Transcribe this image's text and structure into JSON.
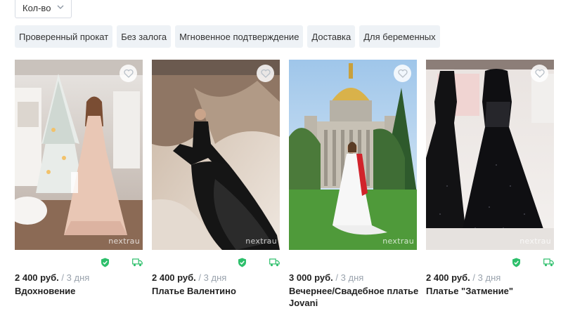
{
  "filters": {
    "quantity_select": {
      "label": "Кол-во"
    },
    "chips": [
      "Проверенный прокат",
      "Без залога",
      "Мгновенное подтверждение",
      "Доставка",
      "Для беременных"
    ]
  },
  "products": [
    {
      "price": "2 400 руб.",
      "period": "/ 3 дня",
      "title": "Вдохновение",
      "watermark": "nextrau",
      "verified": true,
      "delivery": true
    },
    {
      "price": "2 400 руб.",
      "period": "/ 3 дня",
      "title": "Платье Валентино",
      "watermark": "nextrau",
      "verified": true,
      "delivery": true
    },
    {
      "price": "3 000 руб.",
      "period": "/ 3 дня",
      "title": "Вечернее/Свадебное платье Jovani",
      "watermark": "nextrau",
      "verified": false,
      "delivery": false
    },
    {
      "price": "2 400 руб.",
      "period": "/ 3 дня",
      "title": "Платье \"Затмение\"",
      "watermark": "nextrau",
      "verified": true,
      "delivery": true
    }
  ],
  "icons": {
    "favorite": "heart-outline-icon",
    "verified": "shield-check-icon",
    "delivery": "truck-icon",
    "dropdown": "chevron-down-icon"
  },
  "colors": {
    "chip_bg": "#eef2f6",
    "badge_green": "#2dbf6b",
    "price_period": "#9aa3ad"
  }
}
